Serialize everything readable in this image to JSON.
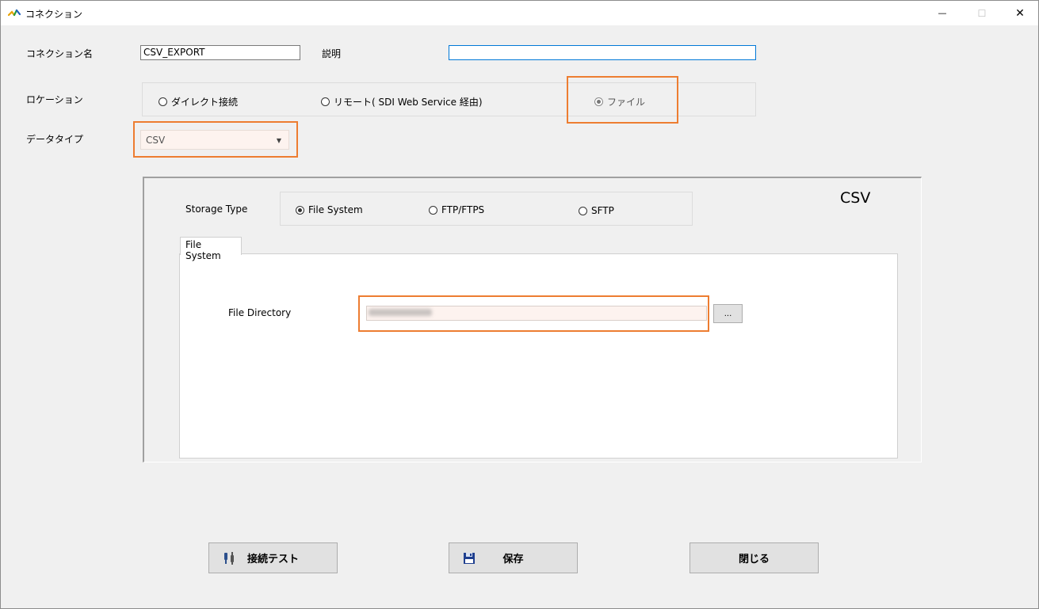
{
  "window": {
    "title": "コネクション",
    "controls": {
      "minimize": "—",
      "maximize": "☐",
      "close": "✕"
    }
  },
  "form": {
    "connection_name_label": "コネクション名",
    "connection_name_value": "CSV_EXPORT",
    "description_label": "説明",
    "description_value": "",
    "location_label": "ロケーション",
    "location_options": [
      {
        "label": "ダイレクト接続",
        "selected": false
      },
      {
        "label": "リモート( SDI Web Service 経由)",
        "selected": false
      },
      {
        "label": "ファイル",
        "selected": true
      }
    ],
    "datatype_label": "データタイプ",
    "datatype_value": "CSV"
  },
  "panel": {
    "title": "CSV",
    "storage_type_label": "Storage Type",
    "storage_options": [
      {
        "label": "File System",
        "selected": true
      },
      {
        "label": "FTP/FTPS",
        "selected": false
      },
      {
        "label": "SFTP",
        "selected": false
      }
    ],
    "tab_label": "File System",
    "file_directory_label": "File Directory",
    "file_directory_value": "",
    "browse_label": "..."
  },
  "buttons": {
    "test_label": "接続テスト",
    "save_label": "保存",
    "close_label": "閉じる"
  },
  "colors": {
    "highlight": "#ed7d31",
    "focus": "#0078d7"
  },
  "icons": [
    "app-logo-icon",
    "plug-icon",
    "floppy-disk-icon"
  ]
}
